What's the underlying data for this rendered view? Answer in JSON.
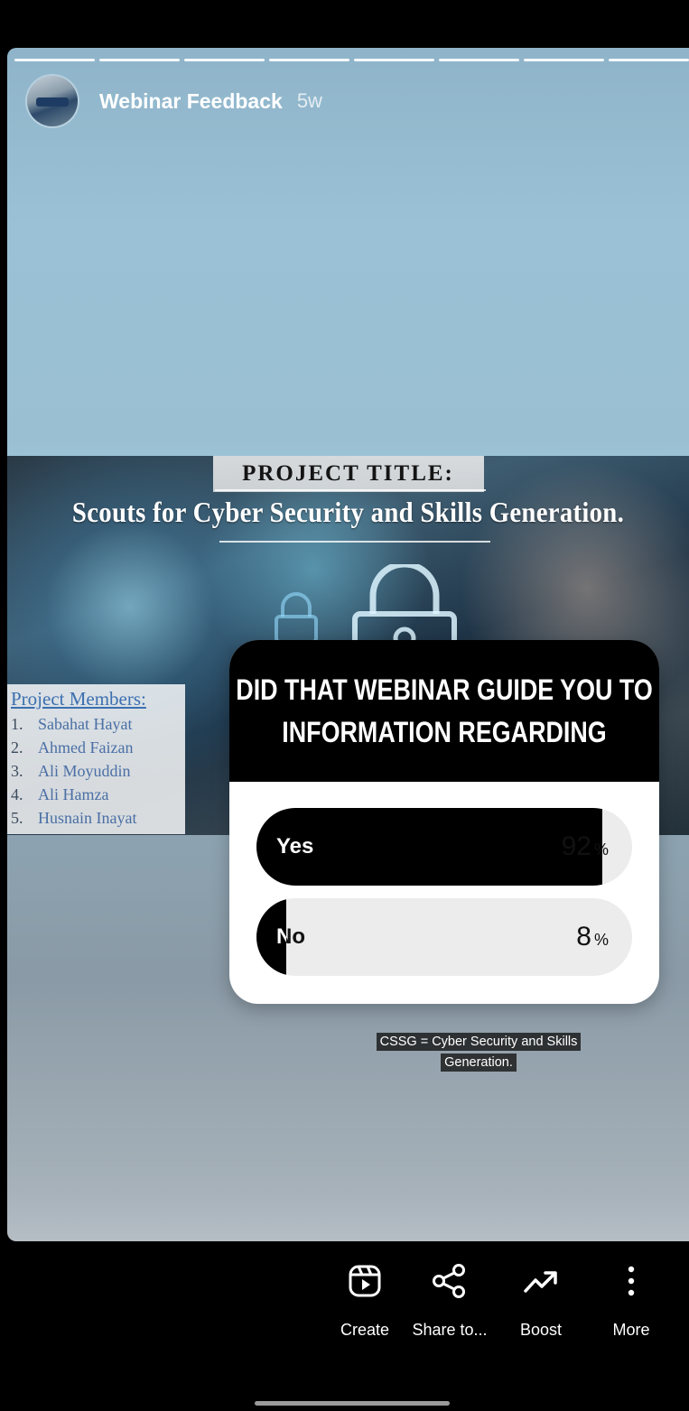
{
  "story": {
    "author": "Webinar Feedback",
    "time": "5w",
    "progress_segments": 8
  },
  "banner": {
    "project_title": "PROJECT TITLE:",
    "title": "Scouts for Cyber Security and Skills Generation.",
    "members_heading": "Project Members:",
    "members": [
      {
        "num": "1.",
        "name": "Sabahat Hayat"
      },
      {
        "num": "2.",
        "name": "Ahmed Faizan"
      },
      {
        "num": "3.",
        "name": "Ali Moyuddin"
      },
      {
        "num": "4.",
        "name": "Ali Hamza"
      },
      {
        "num": "5.",
        "name": "Husnain Inayat"
      }
    ]
  },
  "poll": {
    "question": "DID THAT WEBINAR GUIDE YOU TO INFORMATION REGARDING",
    "options": [
      {
        "label": "Yes",
        "percent": "92",
        "symbol": "%",
        "fill_fraction": 0.92
      },
      {
        "label": "No",
        "percent": "8",
        "symbol": "%",
        "fill_fraction": 0.08
      }
    ]
  },
  "caption": "CSSG = Cyber Security and Skills Generation.",
  "actions": [
    {
      "label": "Create",
      "icon": "reels-icon"
    },
    {
      "label": "Share to...",
      "icon": "share-icon"
    },
    {
      "label": "Boost",
      "icon": "trend-arrow-icon"
    },
    {
      "label": "More",
      "icon": "more-vertical-icon"
    }
  ],
  "colors": {
    "background": "#000000",
    "poll_bar": "#000000",
    "poll_track": "#ececec",
    "member_text": "#4a6fa5"
  }
}
